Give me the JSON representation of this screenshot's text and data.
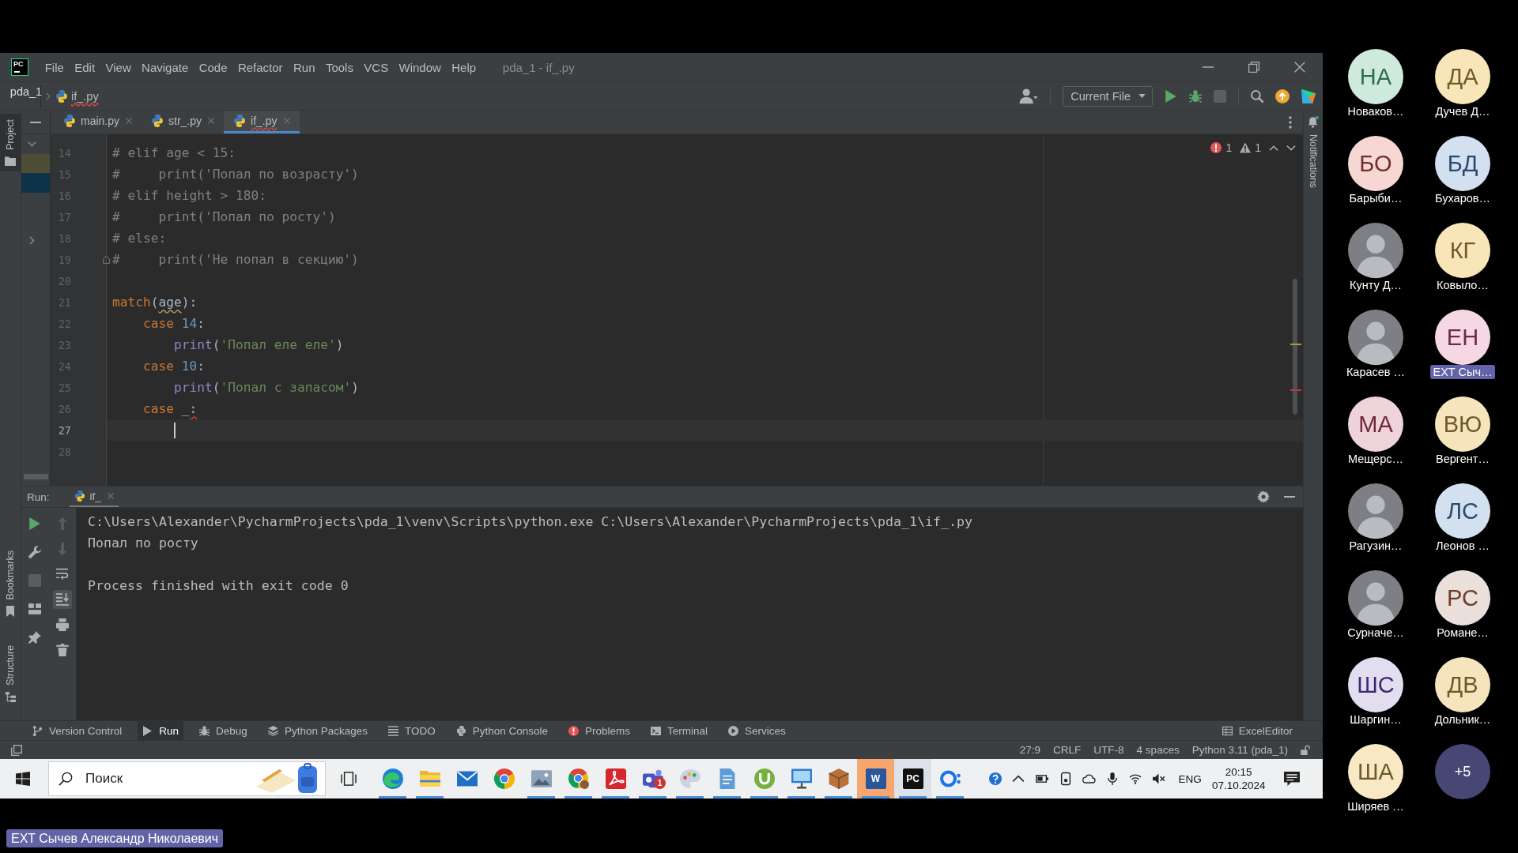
{
  "window": {
    "logo": "PC",
    "menu": [
      "File",
      "Edit",
      "View",
      "Navigate",
      "Code",
      "Refactor",
      "Run",
      "Tools",
      "VCS",
      "Window",
      "Help"
    ],
    "title": "pda_1 - if_.py"
  },
  "navigation_bar": {
    "breadcrumbs": [
      {
        "kind": "project",
        "label": "pda_1",
        "has_error": false
      },
      {
        "kind": "file",
        "label": "if_.py",
        "has_error": true
      }
    ],
    "run_configuration": "Current File",
    "actions": [
      {
        "kind": "run",
        "disabled": false
      },
      {
        "kind": "debug",
        "disabled": false
      },
      {
        "kind": "stop",
        "disabled": true
      }
    ]
  },
  "left_stripe": {
    "top": [
      {
        "kind": "project",
        "label": "Project",
        "selected": true
      }
    ],
    "bottom": [
      {
        "kind": "bookmarks",
        "label": "Bookmarks",
        "selected": false
      },
      {
        "kind": "structure",
        "label": "Structure",
        "selected": false
      }
    ]
  },
  "project_tree": [
    {
      "kind": "folder",
      "expanded": true,
      "selected": false,
      "highlighted": false
    },
    {
      "kind": "item",
      "selected": false,
      "highlighted": true
    },
    {
      "kind": "item",
      "selected": true,
      "highlighted": false
    },
    {
      "kind": "folder",
      "expanded": false,
      "selected": false,
      "highlighted": false
    }
  ],
  "editor_tabs": [
    {
      "label": "main.py",
      "selected": false,
      "has_error": false
    },
    {
      "label": "str_.py",
      "selected": false,
      "has_error": false
    },
    {
      "label": "if_.py",
      "selected": true,
      "has_error": true
    }
  ],
  "editor": {
    "error_count": "1",
    "warning_count": "1",
    "lines": [
      {
        "number": "14",
        "current": false,
        "fold_marker": false,
        "tokens": [
          {
            "kind": "comment",
            "text": "# elif age < 15:"
          }
        ]
      },
      {
        "number": "15",
        "current": false,
        "fold_marker": false,
        "tokens": [
          {
            "kind": "comment",
            "text": "#     print('Попал по возрасту')"
          }
        ]
      },
      {
        "number": "16",
        "current": false,
        "fold_marker": false,
        "tokens": [
          {
            "kind": "comment",
            "text": "# elif height > 180:"
          }
        ]
      },
      {
        "number": "17",
        "current": false,
        "fold_marker": false,
        "tokens": [
          {
            "kind": "comment",
            "text": "#     print('Попал по росту')"
          }
        ]
      },
      {
        "number": "18",
        "current": false,
        "fold_marker": false,
        "tokens": [
          {
            "kind": "comment",
            "text": "# else:"
          }
        ]
      },
      {
        "number": "19",
        "current": false,
        "fold_marker": true,
        "tokens": [
          {
            "kind": "comment",
            "text": "#     print('Не попал в секцию')"
          }
        ]
      },
      {
        "number": "20",
        "current": false,
        "fold_marker": false
      },
      {
        "number": "21",
        "current": false,
        "fold_marker": false,
        "tokens": [
          {
            "kind": "keyword",
            "text": "match"
          },
          {
            "kind": "plain",
            "text": "("
          },
          {
            "kind": "warning",
            "text": "age"
          },
          {
            "kind": "plain",
            "text": "):"
          }
        ]
      },
      {
        "number": "22",
        "current": false,
        "fold_marker": false,
        "tokens": [
          {
            "kind": "keyword",
            "text": "    case"
          },
          {
            "kind": "number",
            "text": " 14"
          },
          {
            "kind": "plain",
            "text": ":"
          }
        ]
      },
      {
        "number": "23",
        "current": false,
        "fold_marker": false,
        "tokens": [
          {
            "kind": "builtin",
            "text": "        print"
          },
          {
            "kind": "plain",
            "text": "("
          },
          {
            "kind": "string",
            "text": "'Попал еле еле'"
          },
          {
            "kind": "plain",
            "text": ")"
          }
        ]
      },
      {
        "number": "24",
        "current": false,
        "fold_marker": false,
        "tokens": [
          {
            "kind": "keyword",
            "text": "    case"
          },
          {
            "kind": "number",
            "text": " 10"
          },
          {
            "kind": "plain",
            "text": ":"
          }
        ]
      },
      {
        "number": "25",
        "current": false,
        "fold_marker": false,
        "tokens": [
          {
            "kind": "builtin",
            "text": "        print"
          },
          {
            "kind": "plain",
            "text": "("
          },
          {
            "kind": "string",
            "text": "'Попал с запасом'"
          },
          {
            "kind": "plain",
            "text": ")"
          }
        ]
      },
      {
        "number": "26",
        "current": false,
        "fold_marker": false,
        "tokens": [
          {
            "kind": "keyword",
            "text": "    case"
          },
          {
            "kind": "plain",
            "text": " _"
          },
          {
            "kind": "error",
            "text": ":"
          }
        ]
      },
      {
        "number": "27",
        "current": true,
        "fold_marker": false
      },
      {
        "number": "28",
        "current": false,
        "fold_marker": false
      }
    ]
  },
  "right_stripe": [
    {
      "kind": "notifications",
      "label": "Notifications",
      "selected": false
    }
  ],
  "run_panel": {
    "title": "Run:",
    "tabs": [
      {
        "label": "if_",
        "selected": true
      }
    ],
    "toolbar_columns": [
      [
        {
          "kind": "rerun",
          "disabled": false,
          "toggled": false
        },
        {
          "kind": "wrench",
          "disabled": false,
          "toggled": false
        },
        {
          "kind": "stop",
          "disabled": true,
          "toggled": false
        },
        {
          "kind": "layout",
          "disabled": false,
          "toggled": false
        },
        {
          "kind": "pin",
          "disabled": false,
          "toggled": false
        }
      ],
      [
        {
          "kind": "up",
          "disabled": true,
          "toggled": false
        },
        {
          "kind": "down",
          "disabled": true,
          "toggled": false
        },
        {
          "kind": "wrap",
          "disabled": false,
          "toggled": false
        },
        {
          "kind": "scroll_end",
          "disabled": false,
          "toggled": true
        },
        {
          "kind": "print",
          "disabled": false,
          "toggled": false
        },
        {
          "kind": "trash",
          "disabled": false,
          "toggled": false
        }
      ]
    ],
    "output": [
      {
        "kind": "command",
        "text": "C:\\Users\\Alexander\\PycharmProjects\\pda_1\\venv\\Scripts\\python.exe C:\\Users\\Alexander\\PycharmProjects\\pda_1\\if_.py"
      },
      {
        "kind": "stdout",
        "text": "Попал по росту"
      },
      {
        "kind": "exit",
        "text": "Process finished with exit code 0"
      }
    ]
  },
  "tool_window_bar": {
    "left": [
      {
        "kind": "vcs",
        "label": "Version Control",
        "selected": false
      },
      {
        "kind": "run",
        "label": "Run",
        "selected": true
      },
      {
        "kind": "debug",
        "label": "Debug",
        "selected": false
      },
      {
        "kind": "packages",
        "label": "Python Packages",
        "selected": false
      },
      {
        "kind": "todo",
        "label": "TODO",
        "selected": false
      },
      {
        "kind": "console",
        "label": "Python Console",
        "selected": false
      },
      {
        "kind": "problems",
        "label": "Problems",
        "selected": false
      },
      {
        "kind": "terminal",
        "label": "Terminal",
        "selected": false
      },
      {
        "kind": "services",
        "label": "Services",
        "selected": false
      }
    ],
    "right": [
      {
        "kind": "grid",
        "label": "ExcelEditor",
        "selected": false
      }
    ]
  },
  "status_bar": {
    "items": [
      "27:9",
      "CRLF",
      "UTF-8",
      "4 spaces",
      "Python 3.11 (pda_1)"
    ]
  },
  "taskbar": {
    "search": {
      "placeholder": "Поиск"
    },
    "apps": [
      {
        "kind": "swirl",
        "running": true,
        "active": false,
        "attention": false
      },
      {
        "kind": "folder",
        "running": true,
        "active": false,
        "attention": false
      },
      {
        "kind": "envelope",
        "running": false,
        "active": false,
        "attention": false
      },
      {
        "kind": "segmented_circle",
        "running": false,
        "active": false,
        "attention": false
      },
      {
        "kind": "picture",
        "running": true,
        "active": false,
        "attention": false
      },
      {
        "kind": "segmented_circle_dot",
        "running": true,
        "active": false,
        "attention": false
      },
      {
        "kind": "loop_tile",
        "running": true,
        "active": false,
        "attention": false
      },
      {
        "kind": "people_tile",
        "badge": "1",
        "running": true,
        "active": false,
        "attention": false
      },
      {
        "kind": "palette",
        "running": true,
        "active": false,
        "attention": false
      },
      {
        "kind": "document",
        "running": true,
        "active": false,
        "attention": false
      },
      {
        "kind": "arc_circle",
        "running": true,
        "active": false,
        "attention": false
      },
      {
        "kind": "monitor",
        "running": true,
        "active": false,
        "attention": false
      },
      {
        "kind": "box",
        "running": true,
        "active": false,
        "attention": false
      },
      {
        "kind": "letter_tile",
        "label": "W",
        "color": "#2b579a",
        "running": true,
        "active": false,
        "attention": true
      },
      {
        "kind": "letter_tile",
        "label": "PC",
        "color": "#111111",
        "running": true,
        "active": true,
        "attention": false
      },
      {
        "kind": "ring_dots",
        "running": true,
        "active": false,
        "attention": false
      }
    ],
    "tray": {
      "language": "ENG",
      "time": "20:15",
      "date": "07.10.2024"
    }
  },
  "participant_rows": [
    [
      {
        "kind": "initials",
        "initials": "НА",
        "name": "Новаков…",
        "color": "#cfe9dc",
        "highlighted": false
      },
      {
        "kind": "initials",
        "initials": "ДА",
        "name": "Дучев Д…",
        "color": "#f8e6b8",
        "highlighted": false
      }
    ],
    [
      {
        "kind": "initials",
        "initials": "БО",
        "name": "Барыби…",
        "color": "#f7d7d4",
        "highlighted": false
      },
      {
        "kind": "initials",
        "initials": "БД",
        "name": "Бухаров…",
        "color": "#d3e0f0",
        "highlighted": false
      }
    ],
    [
      {
        "kind": "photo",
        "name": "Кунту Д…",
        "highlighted": false
      },
      {
        "kind": "initials",
        "initials": "КГ",
        "name": "Ковыло…",
        "color": "#f8e6b8",
        "highlighted": false
      }
    ],
    [
      {
        "kind": "photo",
        "name": "Карасев …",
        "highlighted": false
      },
      {
        "kind": "initials",
        "initials": "ЕН",
        "name": "EXT Сыч…",
        "color": "#f6d8e4",
        "highlighted": true
      }
    ],
    [
      {
        "kind": "initials",
        "initials": "МА",
        "name": "Мещерс…",
        "color": "#eed3da",
        "highlighted": false
      },
      {
        "kind": "initials",
        "initials": "ВЮ",
        "name": "Вергент…",
        "color": "#f6e4bc",
        "highlighted": false
      }
    ],
    [
      {
        "kind": "photo",
        "name": "Рагузин…",
        "highlighted": false
      },
      {
        "kind": "initials",
        "initials": "ЛС",
        "name": "Леонов …",
        "color": "#d3e0f0",
        "highlighted": false
      }
    ],
    [
      {
        "kind": "photo",
        "name": "Сурначе…",
        "highlighted": false
      },
      {
        "kind": "initials",
        "initials": "РС",
        "name": "Романе…",
        "color": "#eadfdb",
        "highlighted": false
      }
    ],
    [
      {
        "kind": "initials",
        "initials": "ШС",
        "name": "Шаргин…",
        "color": "#e2def0",
        "highlighted": false
      },
      {
        "kind": "initials",
        "initials": "ДВ",
        "name": "Дольник…",
        "color": "#f6e4bc",
        "highlighted": false
      }
    ],
    [
      {
        "kind": "initials",
        "initials": "ША",
        "name": "Ширяев …",
        "color": "#f8e8c4",
        "highlighted": false
      }
    ]
  ],
  "more_participants": {
    "label": "+5"
  },
  "presenter_label": "EXT Сычев Александр Николаевич"
}
